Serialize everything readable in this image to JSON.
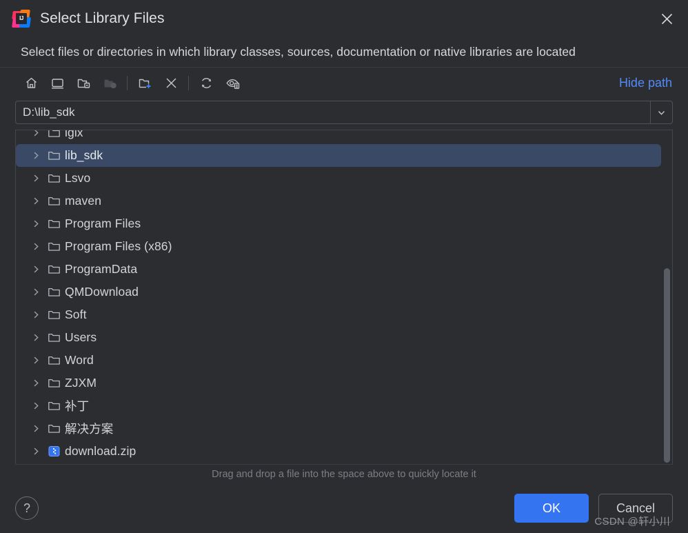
{
  "window": {
    "title": "Select Library Files",
    "logo_text": "IJ",
    "close_icon": "close-icon"
  },
  "subtitle": "Select files or directories in which library classes, sources, documentation or native libraries are located",
  "toolbar": {
    "buttons": [
      {
        "name": "home-icon",
        "title": "Home",
        "disabled": false
      },
      {
        "name": "desktop-icon",
        "title": "Desktop",
        "disabled": false
      },
      {
        "name": "drive-folder-icon",
        "title": "Drive",
        "disabled": false
      },
      {
        "name": "project-folder-icon",
        "title": "Project Directory",
        "disabled": true
      },
      {
        "name": "new-folder-icon",
        "title": "New Folder",
        "disabled": false
      },
      {
        "name": "delete-icon",
        "title": "Delete",
        "disabled": false
      },
      {
        "name": "refresh-icon",
        "title": "Refresh",
        "disabled": false
      },
      {
        "name": "show-hidden-icon",
        "title": "Show Hidden Files",
        "disabled": false
      }
    ],
    "hide_path_label": "Hide path",
    "hide_path_color": "#548af7"
  },
  "path": {
    "value": "D:\\lib_sdk",
    "placeholder": "",
    "dropdown_icon": "chevron-down-icon"
  },
  "tree": {
    "selected_index": 1,
    "selection_color": "#3a4a66",
    "items": [
      {
        "label": "igix",
        "type": "folder",
        "expandable": true
      },
      {
        "label": "lib_sdk",
        "type": "folder",
        "expandable": true
      },
      {
        "label": "Lsvo",
        "type": "folder",
        "expandable": true
      },
      {
        "label": "maven",
        "type": "folder",
        "expandable": true
      },
      {
        "label": "Program Files",
        "type": "folder",
        "expandable": true
      },
      {
        "label": "Program Files (x86)",
        "type": "folder",
        "expandable": true
      },
      {
        "label": "ProgramData",
        "type": "folder",
        "expandable": true
      },
      {
        "label": "QMDownload",
        "type": "folder",
        "expandable": true
      },
      {
        "label": "Soft",
        "type": "folder",
        "expandable": true
      },
      {
        "label": "Users",
        "type": "folder",
        "expandable": true
      },
      {
        "label": "Word",
        "type": "folder",
        "expandable": true
      },
      {
        "label": "ZJXM",
        "type": "folder",
        "expandable": true
      },
      {
        "label": "补丁",
        "type": "folder",
        "expandable": true
      },
      {
        "label": "解决方案",
        "type": "folder",
        "expandable": true
      },
      {
        "label": "download.zip",
        "type": "archive",
        "expandable": true
      }
    ]
  },
  "hint": "Drag and drop a file into the space above to quickly locate it",
  "footer": {
    "help_label": "?",
    "ok_label": "OK",
    "cancel_label": "Cancel",
    "ok_color": "#3574f0"
  },
  "watermark": "CSDN @轩小川"
}
